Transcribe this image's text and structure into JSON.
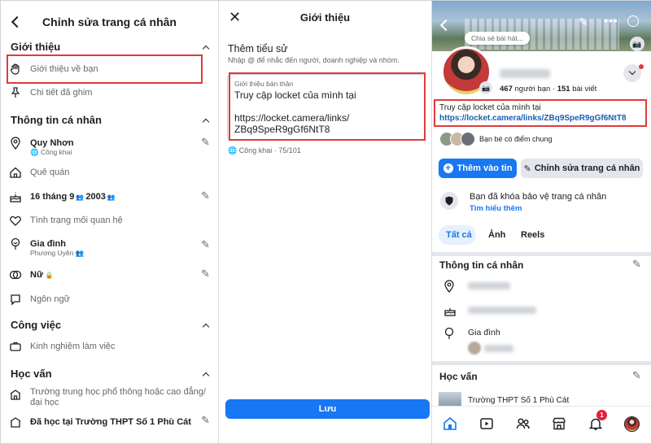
{
  "left_panel": {
    "title": "Chỉnh sửa trang cá nhân",
    "section_intro": "Giới thiệu",
    "intro_items": [
      "Giới thiệu về bạn",
      "Chi tiết đã ghim"
    ],
    "section_personal": "Thông tin cá nhân",
    "city": "Quy Nhơn",
    "city_privacy": "Công khai",
    "hometown": "Quê quán",
    "birthday": "16 tháng 9",
    "birth_year": "2003",
    "relationship": "Tình trạng mối quan hệ",
    "family": "Gia đình",
    "family_member": "Phương Uyên",
    "gender": "Nữ",
    "language": "Ngôn ngữ",
    "section_work": "Công việc",
    "work_item": "Kinh nghiệm làm việc",
    "section_edu": "Học vấn",
    "edu_item": "Trường trung học phổ thông hoặc cao đẳng/ đại học",
    "edu_school": "Đã học tại Trường THPT Số 1 Phù Cát"
  },
  "middle_panel": {
    "title": "Giới thiệu",
    "heading": "Thêm tiểu sử",
    "hint": "Nhập @ để nhắc đến người, doanh nghiệp và nhóm.",
    "field_label": "Giới thiệu bản thân",
    "bio_line1": "Truy cập locket của mình tại",
    "bio_line2": "https://locket.camera/links/",
    "bio_line3": "ZBq9SpeR9gGf6NtT8",
    "privacy_counter": "Công khai · 75/101",
    "save_label": "Lưu"
  },
  "right_panel": {
    "share_placeholder": "Chia sẻ bài hát...",
    "friends_count": "467",
    "friends_label": "người bạn",
    "posts_count": "151",
    "posts_label": "bài viết",
    "bio_text": "Truy cập locket của mình tại",
    "bio_link": "https://locket.camera/links/ZBq9SpeR9gGf6NtT8",
    "mutual_friends": "Bạn bè có điểm chung",
    "add_story": "Thêm vào tin",
    "edit_profile": "Chỉnh sửa trang cá nhân",
    "locked_text": "Bạn đã khóa bảo vệ trang cá nhân",
    "learn_more": "Tìm hiểu thêm",
    "tabs": [
      "Tất cả",
      "Ảnh",
      "Reels"
    ],
    "section_personal": "Thông tin cá nhân",
    "family": "Gia đình",
    "section_edu": "Học vấn",
    "school": "Trường THPT Số 1 Phù Cát",
    "notif_badge": "1"
  },
  "colors": {
    "accent": "#1877f2",
    "highlight_box": "#e03b3b",
    "muted": "#65676b"
  }
}
